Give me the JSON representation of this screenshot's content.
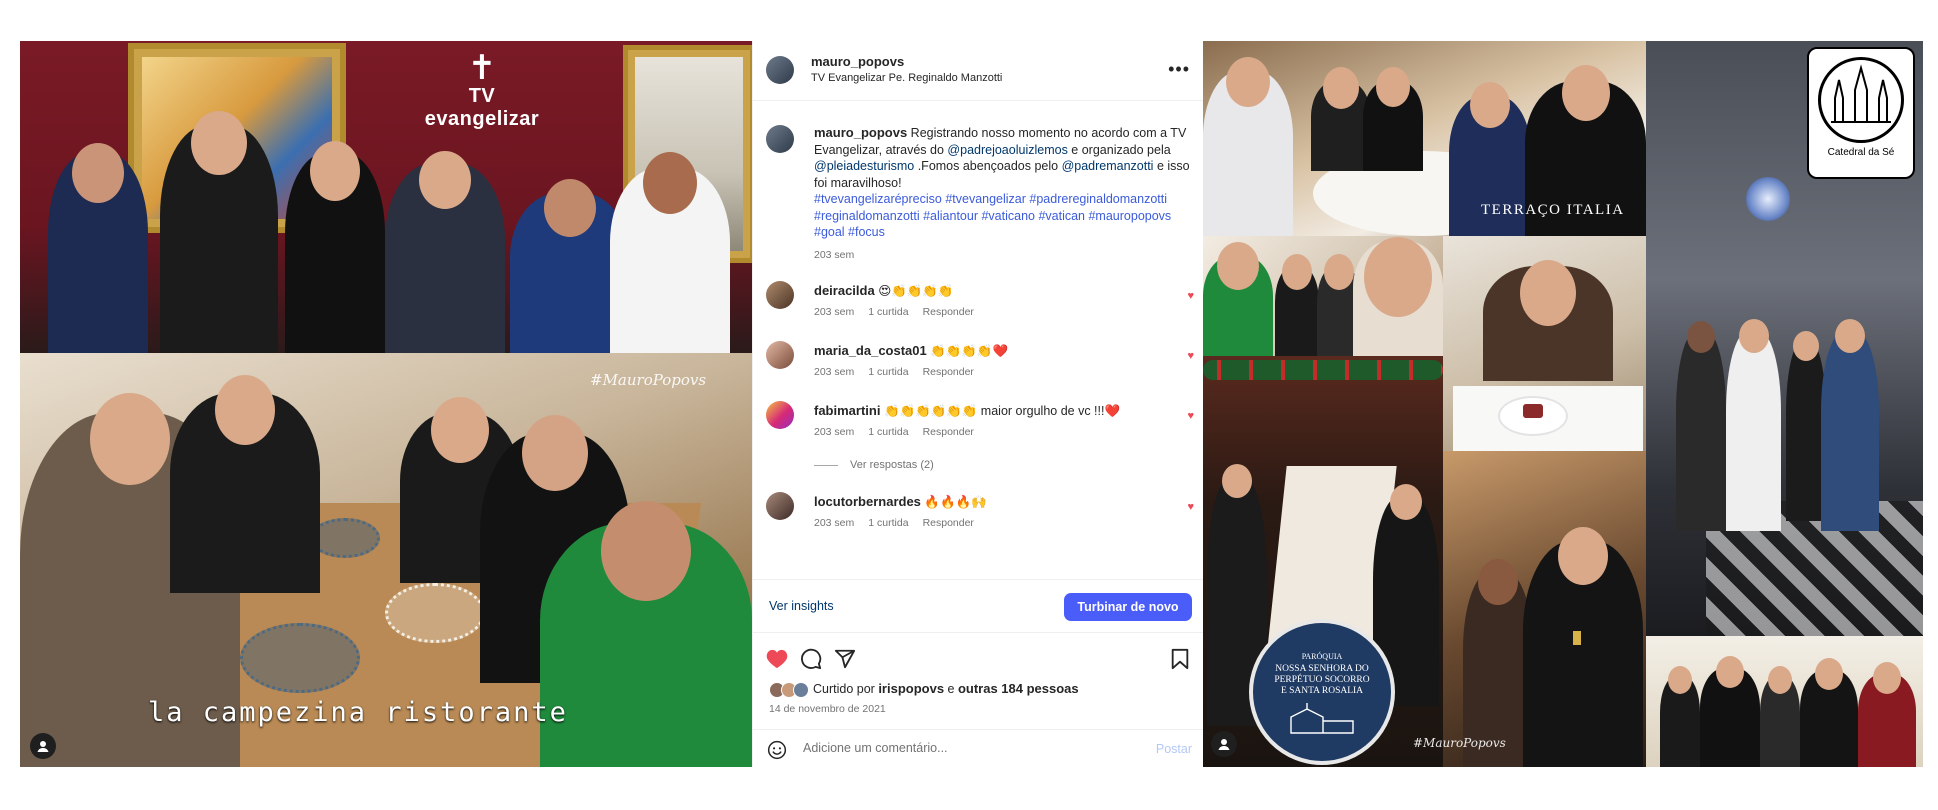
{
  "left_media": {
    "tv_logo": "TV evangelizar",
    "restaurant_caption": "la campezina ristorante",
    "watermark": "#MauroPopovs"
  },
  "post": {
    "author": "mauro_popovs",
    "location": "TV Evangelizar Pe. Reginaldo Manzotti",
    "caption": {
      "author": "mauro_popovs",
      "text_1": "Registrando nosso momento no acordo com a TV Evangelizar, através do ",
      "mention_1": "@padrejoaoluizlemos",
      "text_2": " e organizado pela ",
      "mention_2": "@pleiadesturismo",
      "text_3": " .Fomos abençoados pelo ",
      "mention_3": "@padremanzotti",
      "text_4": " e isso foi maravilhoso!",
      "hashtags": "#tvevangelizarépreciso #tvevangelizar #padrereginaldomanzotti #reginaldomanzotti #aliantour #vaticano #vatican #mauropopovs #goal #focus",
      "time": "203 sem"
    },
    "comments": [
      {
        "user": "deiracilda",
        "text": "😍👏👏👏👏",
        "time": "203 sem",
        "likes": "1 curtida",
        "reply": "Responder"
      },
      {
        "user": "maria_da_costa01",
        "text": "👏👏👏👏❤️",
        "time": "203 sem",
        "likes": "1 curtida",
        "reply": "Responder"
      },
      {
        "user": "fabimartini",
        "text": "👏👏👏👏👏👏 maior orgulho de vc !!!❤️",
        "time": "203 sem",
        "likes": "1 curtida",
        "reply": "Responder"
      },
      {
        "user": "locutorbernardes",
        "text": "🔥🔥🔥🙌",
        "time": "203 sem",
        "likes": "1 curtida",
        "reply": "Responder"
      }
    ],
    "view_replies": "Ver respostas (2)",
    "insights_link": "Ver insights",
    "boost_button": "Turbinar de novo",
    "liked_by_prefix": "Curtido por ",
    "liked_by_user": "irispopovs",
    "liked_by_suffix": " e ",
    "liked_by_others": "outras 184 pessoas",
    "date": "14 de novembro de 2021",
    "comment_placeholder": "Adicione um comentário...",
    "post_button": "Postar"
  },
  "right_media": {
    "terraco_label": "TERRAÇO ITALIA",
    "cathedral_label": "Catedral da Sé",
    "parish_small": "PARÓQUIA",
    "parish_name": "NOSSA SENHORA DO PERPÉTUO SOCORRO E SANTA ROSALIA",
    "watermark": "#MauroPopovs"
  },
  "colors": {
    "like_red": "#ed4956",
    "boost_blue": "#4a5df9",
    "link_blue": "#00376b",
    "hashtag_blue": "#3b5bdb"
  },
  "icons": [
    "more-options-icon",
    "heart-icon",
    "comment-icon",
    "share-icon",
    "bookmark-icon",
    "emoji-icon",
    "tag-people-icon",
    "instagram-logo-icon"
  ]
}
